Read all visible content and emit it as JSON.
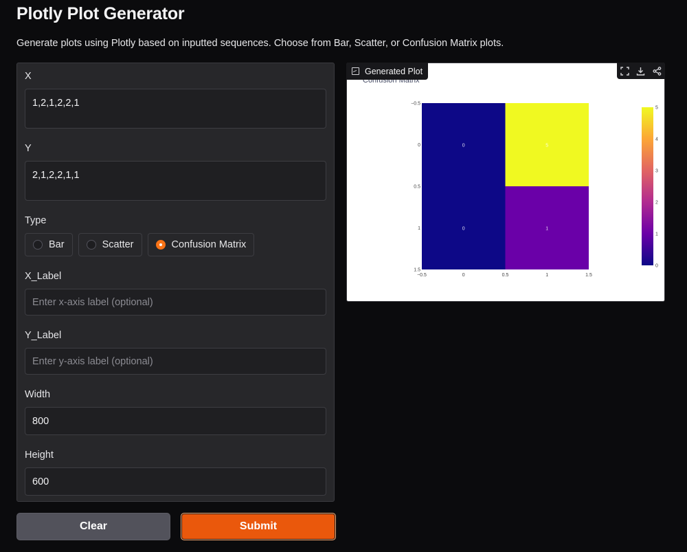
{
  "header": {
    "title": "Plotly Plot Generator",
    "description": "Generate plots using Plotly based on inputted sequences. Choose from Bar, Scatter, or Confusion Matrix plots."
  },
  "form": {
    "x": {
      "label": "X",
      "value": "1,2,1,2,2,1"
    },
    "y": {
      "label": "Y",
      "value": "2,1,2,2,1,1"
    },
    "type": {
      "label": "Type",
      "options": [
        "Bar",
        "Scatter",
        "Confusion Matrix"
      ],
      "selected": "Confusion Matrix"
    },
    "x_label": {
      "label": "X_Label",
      "value": "",
      "placeholder": "Enter x-axis label (optional)"
    },
    "y_label": {
      "label": "Y_Label",
      "value": "",
      "placeholder": "Enter y-axis label (optional)"
    },
    "width": {
      "label": "Width",
      "value": "800"
    },
    "height": {
      "label": "Height",
      "value": "600"
    }
  },
  "buttons": {
    "clear": "Clear",
    "submit": "Submit"
  },
  "output": {
    "label": "Generated Plot",
    "tools": [
      "fullscreen-icon",
      "download-icon",
      "share-icon"
    ]
  },
  "colors": {
    "accent": "#ea580c",
    "panel": "#27272a",
    "background": "#0b0b0d"
  },
  "chart_data": {
    "type": "heatmap",
    "title": "Confusion Matrix",
    "x": [
      0,
      1
    ],
    "y": [
      0,
      1
    ],
    "z": [
      [
        0,
        5
      ],
      [
        0,
        1
      ]
    ],
    "xlim": [
      -0.5,
      1.5
    ],
    "ylim": [
      1.5,
      -0.5
    ],
    "x_ticks": [
      "−0.5",
      "0",
      "0.5",
      "1",
      "1.5"
    ],
    "y_ticks": [
      "−0.5",
      "0",
      "0.5",
      "1",
      "1.5"
    ],
    "colorscale": "plasma",
    "colorbar_range": [
      0,
      5
    ],
    "colorbar_ticks": [
      "0",
      "1",
      "2",
      "3",
      "4",
      "5"
    ],
    "xlabel": "",
    "ylabel": ""
  }
}
